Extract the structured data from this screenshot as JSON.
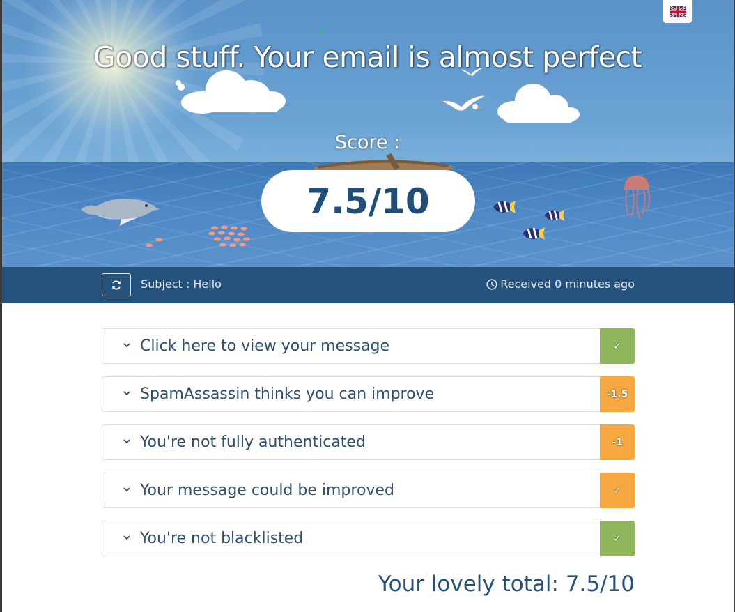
{
  "hero": {
    "title": "Good stuff. Your email is almost perfect",
    "score_label": "Score :",
    "score_value": "7.5/10"
  },
  "language": {
    "icon": "uk-flag-icon"
  },
  "info_bar": {
    "subject": "Subject : Hello",
    "received": "Received 0 minutes ago",
    "refresh_icon": "refresh-icon",
    "clock_icon": "clock-icon"
  },
  "checks": [
    {
      "label": "Click here to view your message",
      "badge": "✓",
      "status": "pass",
      "color": "#8fb65b"
    },
    {
      "label": "SpamAssassin thinks you can improve",
      "badge": "-1.5",
      "status": "warn",
      "color": "#f5a940"
    },
    {
      "label": "You're not fully authenticated",
      "badge": "-1",
      "status": "warn",
      "color": "#f5a940"
    },
    {
      "label": "Your message could be improved",
      "badge": "✓",
      "status": "warn",
      "color": "#f5a940"
    },
    {
      "label": "You're not blacklisted",
      "badge": "✓",
      "status": "pass",
      "color": "#8fb65b"
    }
  ],
  "total": "Your lovely total: 7.5/10",
  "colors": {
    "header_bar": "#24527d",
    "pass": "#8fb65b",
    "warn": "#f5a940",
    "text": "#2d4e6f"
  }
}
